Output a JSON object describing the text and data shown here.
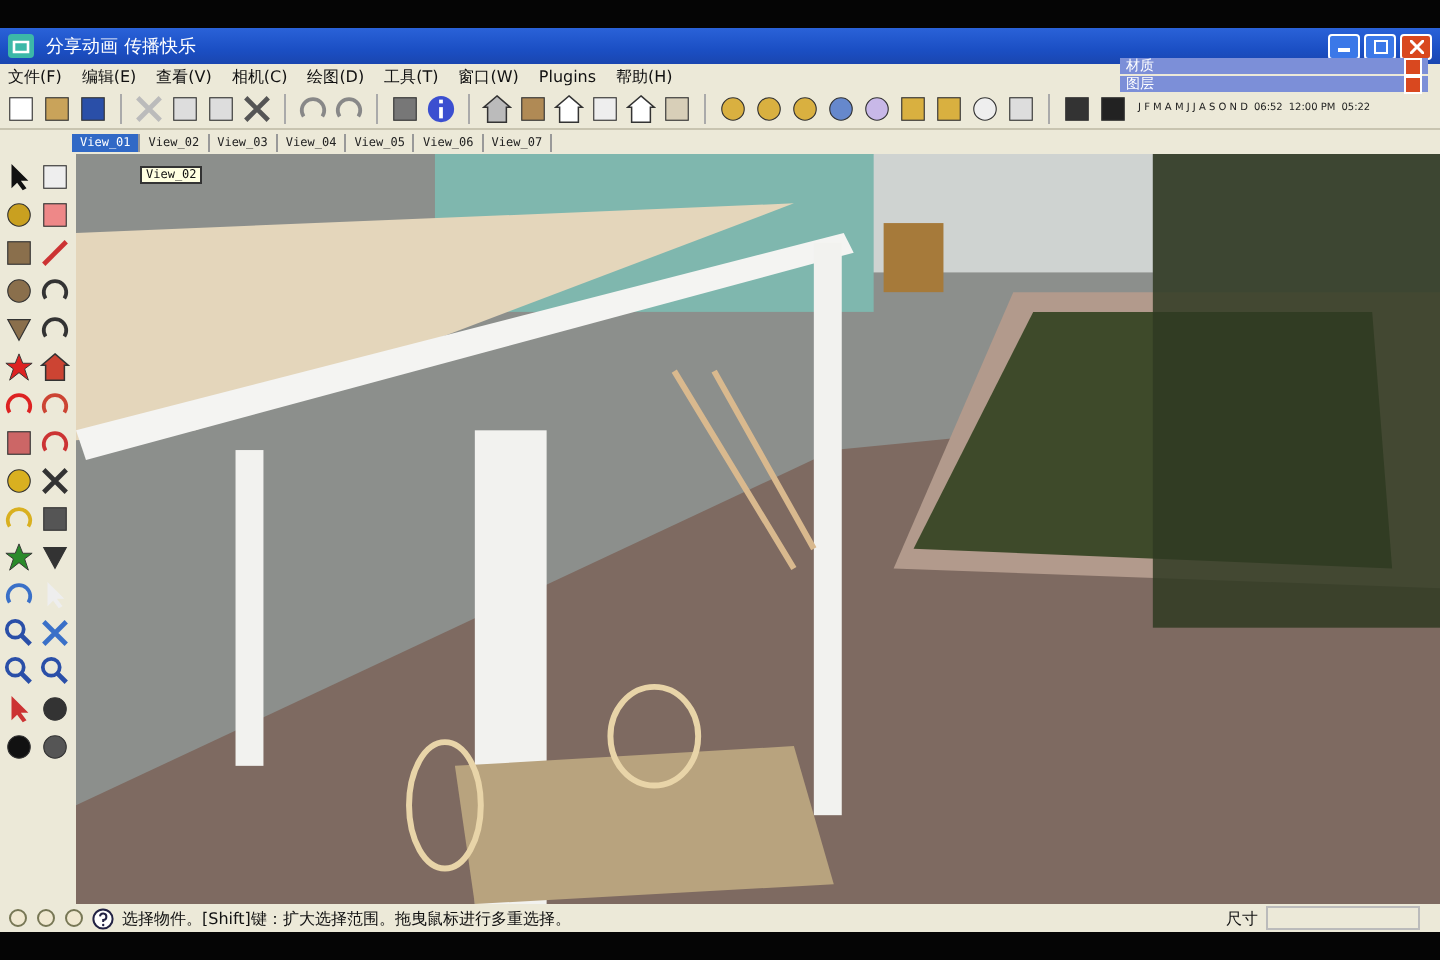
{
  "window": {
    "title": "分享动画 传播快乐"
  },
  "menu": [
    "文件(F)",
    "编辑(E)",
    "查看(V)",
    "相机(C)",
    "绘图(D)",
    "工具(T)",
    "窗口(W)",
    "Plugins",
    "帮助(H)"
  ],
  "scenes": [
    {
      "label": "View_01",
      "selected": true
    },
    {
      "label": "View_02",
      "selected": false
    },
    {
      "label": "View_03",
      "selected": false
    },
    {
      "label": "View_04",
      "selected": false
    },
    {
      "label": "View_05",
      "selected": false
    },
    {
      "label": "View_06",
      "selected": false
    },
    {
      "label": "View_07",
      "selected": false
    }
  ],
  "tooltip": "View_02",
  "panels": [
    {
      "title": "材质"
    },
    {
      "title": "图层"
    }
  ],
  "shadow_toolbar": {
    "months": "J F M A M J J A S O N D",
    "sunrise": "06:52",
    "noon": "12:00 PM",
    "sunset": "05:22"
  },
  "status_bar": {
    "message": "选择物件。[Shift]键：扩大选择范围。拖曳鼠标进行多重选择。",
    "measurements_label": "尺寸"
  }
}
